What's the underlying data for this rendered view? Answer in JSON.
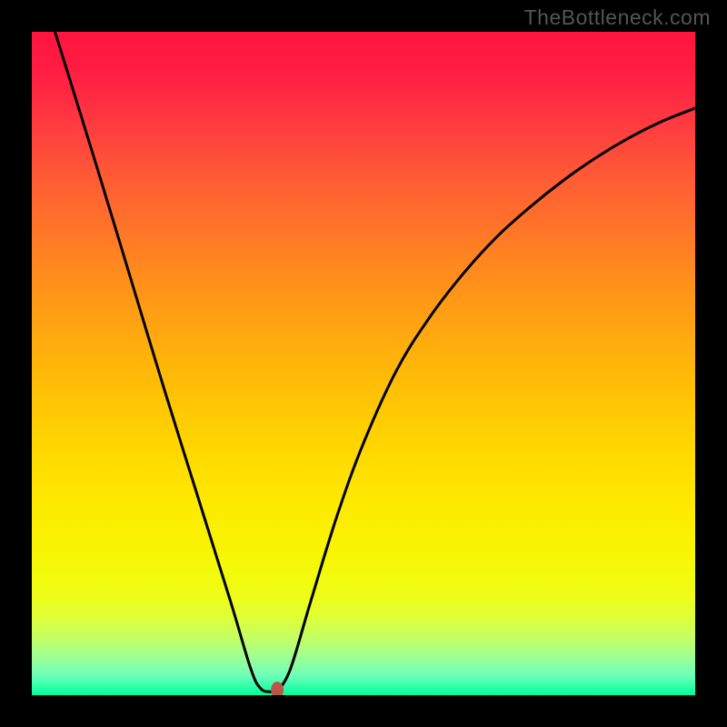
{
  "watermark": "TheBottleneck.com",
  "chart_data": {
    "type": "line",
    "title": "",
    "xlabel": "",
    "ylabel": "",
    "xlim": [
      0,
      100
    ],
    "ylim": [
      0,
      100
    ],
    "gradient": {
      "direction": "top-to-bottom",
      "description": "red at top through orange, yellow, to green at bottom",
      "stops": [
        {
          "pos": 0,
          "color": "#ff153f"
        },
        {
          "pos": 50,
          "color": "#ffb509"
        },
        {
          "pos": 75,
          "color": "#fbf000"
        },
        {
          "pos": 100,
          "color": "#00ff9a"
        }
      ]
    },
    "series": [
      {
        "name": "left-branch",
        "description": "Steep descending line from top-left toward minimum",
        "points": [
          {
            "x": 3.5,
            "y": 100
          },
          {
            "x": 10,
            "y": 79
          },
          {
            "x": 15,
            "y": 62.5
          },
          {
            "x": 20,
            "y": 46
          },
          {
            "x": 25,
            "y": 30
          },
          {
            "x": 30,
            "y": 14
          },
          {
            "x": 33,
            "y": 4
          },
          {
            "x": 34.5,
            "y": 1
          },
          {
            "x": 36,
            "y": 0.5
          }
        ]
      },
      {
        "name": "right-branch",
        "description": "Curve rising from minimum toward upper right, concave down",
        "points": [
          {
            "x": 37,
            "y": 0.5
          },
          {
            "x": 39,
            "y": 4
          },
          {
            "x": 42,
            "y": 14
          },
          {
            "x": 46,
            "y": 27
          },
          {
            "x": 50,
            "y": 38
          },
          {
            "x": 55,
            "y": 49
          },
          {
            "x": 60,
            "y": 57
          },
          {
            "x": 65,
            "y": 63.5
          },
          {
            "x": 70,
            "y": 69
          },
          {
            "x": 75,
            "y": 73.5
          },
          {
            "x": 80,
            "y": 77.5
          },
          {
            "x": 85,
            "y": 81
          },
          {
            "x": 90,
            "y": 84
          },
          {
            "x": 95,
            "y": 86.5
          },
          {
            "x": 100,
            "y": 88.5
          }
        ]
      }
    ],
    "marker": {
      "x": 37,
      "y": 0.8,
      "color": "#bb5548",
      "shape": "ellipse"
    }
  }
}
